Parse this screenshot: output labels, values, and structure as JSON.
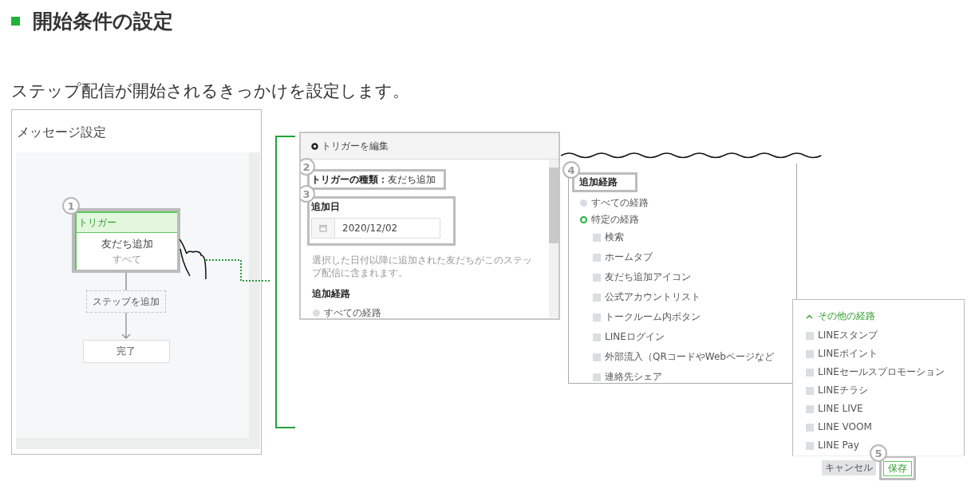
{
  "heading": "開始条件の設定",
  "intro": "ステップ配信が開始されるきっかけを設定します。",
  "message_settings": {
    "title": "メッセージ設定",
    "trigger_node": {
      "badge": "1",
      "header": "トリガー",
      "title": "友だち追加",
      "subtitle": "すべて"
    },
    "add_step": "ステップを追加",
    "finish": "完了"
  },
  "trigger_editor": {
    "title": "トリガーを編集",
    "type": {
      "badge": "2",
      "label": "トリガーの種類：",
      "value": "友だち追加"
    },
    "date": {
      "badge": "3",
      "label": "追加日",
      "value": "2020/12/02"
    },
    "hint": "選択した日付以降に追加された友だちがこのステップ配信に含まれます。",
    "route_label": "追加経路",
    "routes": [
      {
        "label": "すべての経路",
        "selected": false
      }
    ]
  },
  "route_panel": {
    "badge": "4",
    "label": "追加経路",
    "routes": [
      {
        "label": "すべての経路",
        "selected": false
      },
      {
        "label": "特定の経路",
        "selected": true
      }
    ],
    "options": [
      {
        "label": "検索",
        "checked": false
      },
      {
        "label": "ホームタブ",
        "checked": false
      },
      {
        "label": "友だち追加アイコン",
        "checked": false
      },
      {
        "label": "公式アカウントリスト",
        "checked": false
      },
      {
        "label": "トークルーム内ボタン",
        "checked": false
      },
      {
        "label": "LINEログイン",
        "checked": false
      },
      {
        "label": "外部流入（QRコードやWebページなど",
        "checked": false
      },
      {
        "label": "連絡先シェア",
        "checked": false
      }
    ]
  },
  "other_routes": {
    "title": "その他の経路",
    "expanded": true,
    "options": [
      {
        "label": "LINEスタンプ",
        "checked": false
      },
      {
        "label": "LINEポイント",
        "checked": false
      },
      {
        "label": "LINEセールスプロモーション",
        "checked": false
      },
      {
        "label": "LINEチラシ",
        "checked": false
      },
      {
        "label": "LINE LIVE",
        "checked": false
      },
      {
        "label": "LINE VOOM",
        "checked": false
      },
      {
        "label": "LINE Pay",
        "checked": false
      }
    ],
    "cancel": "キャンセル",
    "save_badge": "5",
    "save": "保存"
  }
}
